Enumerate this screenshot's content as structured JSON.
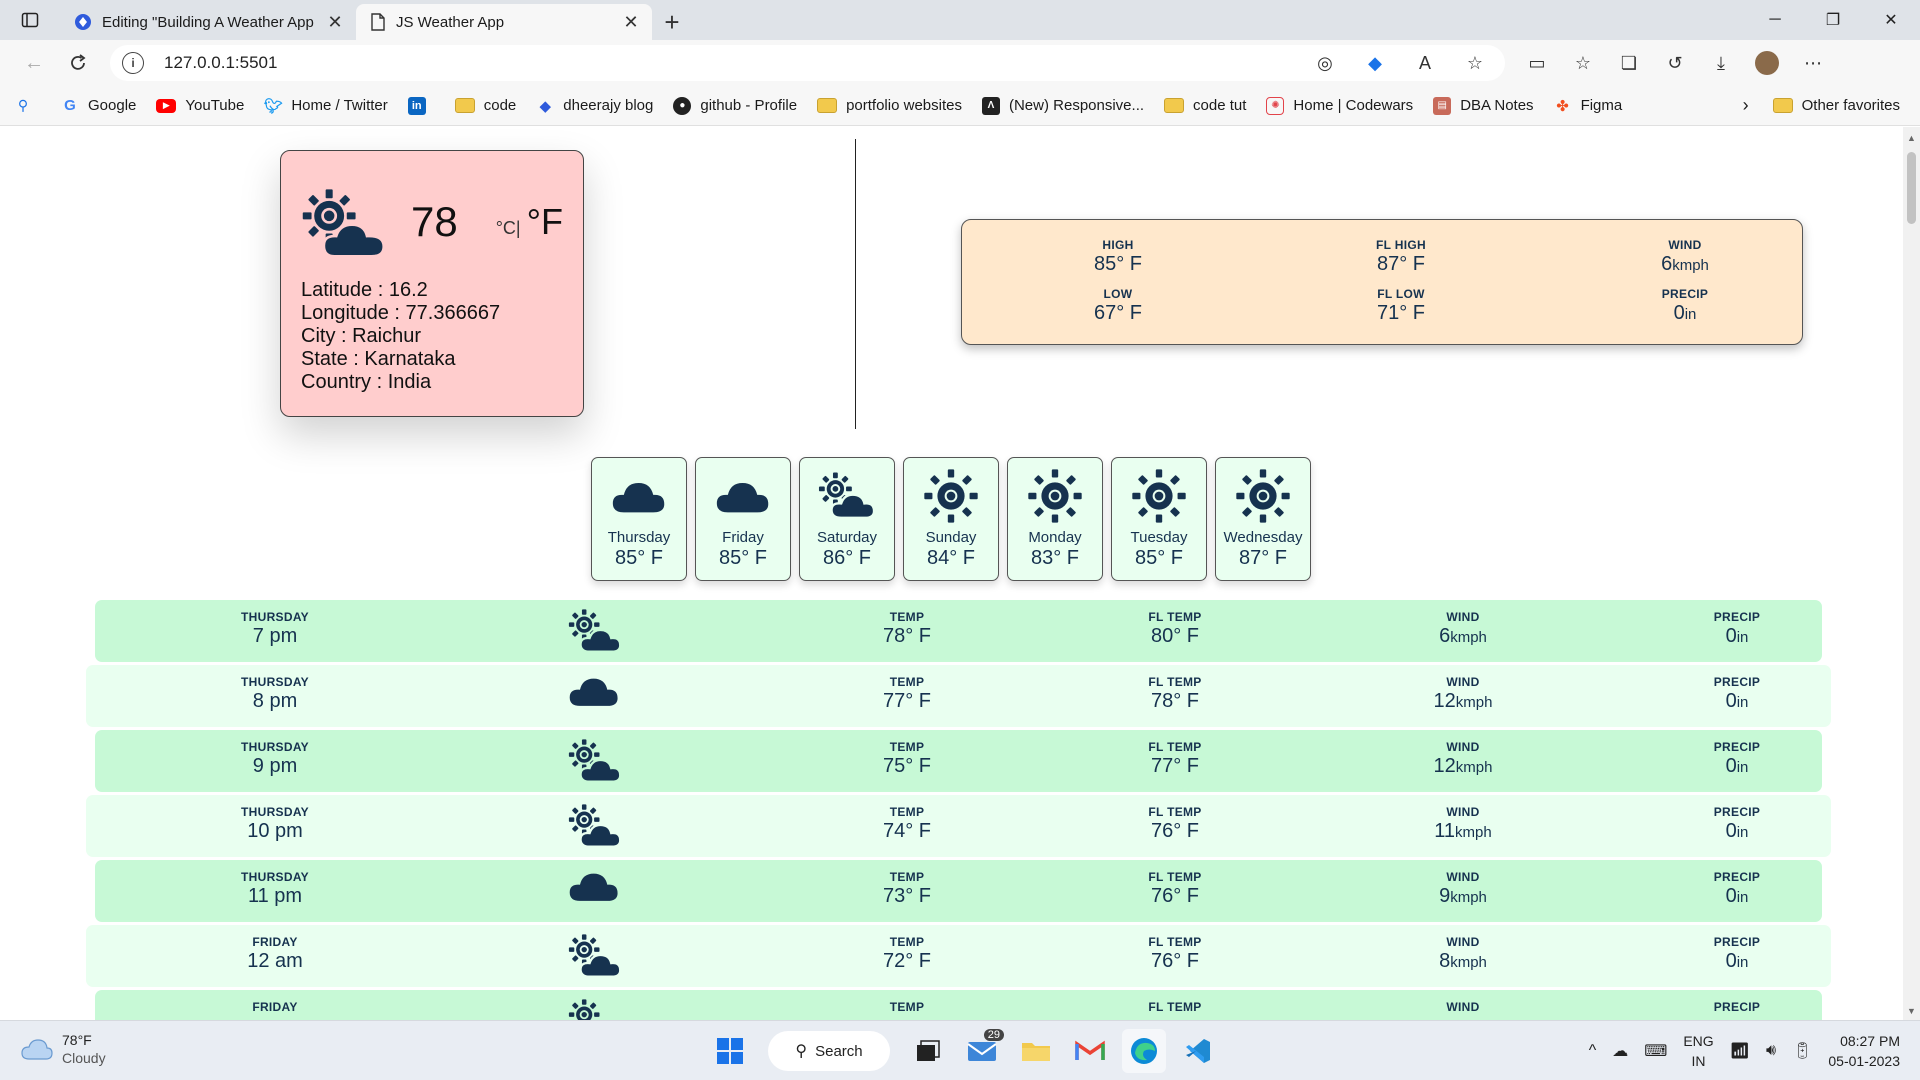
{
  "browser": {
    "tabs": [
      {
        "title": "Editing \"Building A Weather App",
        "active": false
      },
      {
        "title": "JS Weather App",
        "active": true
      }
    ],
    "url": "127.0.0.1:5501",
    "bookmarks": [
      {
        "label": "Google",
        "icon": "google-icon"
      },
      {
        "label": "YouTube",
        "icon": "youtube-icon"
      },
      {
        "label": "Home / Twitter",
        "icon": "twitter-icon"
      },
      {
        "label": "",
        "icon": "linkedin-icon"
      },
      {
        "label": "code",
        "icon": "folder-icon"
      },
      {
        "label": "dheerajy blog",
        "icon": "blog-icon"
      },
      {
        "label": "github - Profile",
        "icon": "github-icon"
      },
      {
        "label": "portfolio websites",
        "icon": "folder-icon"
      },
      {
        "label": "(New) Responsive...",
        "icon": "responsive-icon"
      },
      {
        "label": "code tut",
        "icon": "folder-icon"
      },
      {
        "label": "Home | Codewars",
        "icon": "codewars-icon"
      },
      {
        "label": "DBA Notes",
        "icon": "notes-icon"
      },
      {
        "label": "Figma",
        "icon": "figma-icon"
      }
    ],
    "other_favorites": "Other favorites"
  },
  "current": {
    "temp": "78",
    "unit_c": "°C|",
    "unit_f": "°F",
    "latitude": "Latitude : 16.2",
    "longitude": "Longitude : 77.366667",
    "city": "City : Raichur",
    "state": "State : Karnataka",
    "country": "Country : India",
    "icon": "partly-cloudy-icon"
  },
  "summary": {
    "high_label": "HIGH",
    "high": "85° F",
    "low_label": "LOW",
    "low": "67° F",
    "fl_high_label": "FL HIGH",
    "fl_high": "87° F",
    "fl_low_label": "FL LOW",
    "fl_low": "71° F",
    "wind_label": "WIND",
    "wind": "6",
    "wind_unit": "kmph",
    "precip_label": "PRECIP",
    "precip": "0",
    "precip_unit": "in"
  },
  "daily": [
    {
      "day": "Thursday",
      "temp": "85° F",
      "icon": "cloud"
    },
    {
      "day": "Friday",
      "temp": "85° F",
      "icon": "cloud"
    },
    {
      "day": "Saturday",
      "temp": "86° F",
      "icon": "partly"
    },
    {
      "day": "Sunday",
      "temp": "84° F",
      "icon": "sun"
    },
    {
      "day": "Monday",
      "temp": "83° F",
      "icon": "sun"
    },
    {
      "day": "Tuesday",
      "temp": "85° F",
      "icon": "sun"
    },
    {
      "day": "Wednesday",
      "temp": "87° F",
      "icon": "sun"
    }
  ],
  "hourly_labels": {
    "temp": "TEMP",
    "fl_temp": "FL TEMP",
    "wind": "WIND",
    "precip": "PRECIP",
    "wind_unit": "kmph",
    "precip_unit": "in"
  },
  "hourly": [
    {
      "day": "THURSDAY",
      "time": "7 pm",
      "icon": "partly",
      "temp": "78° F",
      "fl": "80° F",
      "wind": "6",
      "precip": "0"
    },
    {
      "day": "THURSDAY",
      "time": "8 pm",
      "icon": "cloud",
      "temp": "77° F",
      "fl": "78° F",
      "wind": "12",
      "precip": "0"
    },
    {
      "day": "THURSDAY",
      "time": "9 pm",
      "icon": "partly",
      "temp": "75° F",
      "fl": "77° F",
      "wind": "12",
      "precip": "0"
    },
    {
      "day": "THURSDAY",
      "time": "10 pm",
      "icon": "partly",
      "temp": "74° F",
      "fl": "76° F",
      "wind": "11",
      "precip": "0"
    },
    {
      "day": "THURSDAY",
      "time": "11 pm",
      "icon": "cloud",
      "temp": "73° F",
      "fl": "76° F",
      "wind": "9",
      "precip": "0"
    },
    {
      "day": "FRIDAY",
      "time": "12 am",
      "icon": "partly",
      "temp": "72° F",
      "fl": "76° F",
      "wind": "8",
      "precip": "0"
    },
    {
      "day": "FRIDAY",
      "time": "",
      "icon": "partly",
      "temp": "",
      "fl": "",
      "wind": "",
      "precip": ""
    }
  ],
  "taskbar": {
    "weather_temp": "78°F",
    "weather_desc": "Cloudy",
    "search_label": "Search",
    "mail_badge": "29",
    "lang_top": "ENG",
    "lang_bottom": "IN",
    "time": "08:27 PM",
    "date": "05-01-2023"
  },
  "colors": {
    "icon": "#16324f",
    "current_card": "#ffcdcd",
    "summary_card": "#ffe8cc",
    "row_dark": "#c7f9d6",
    "row_light": "#e9fff0"
  }
}
